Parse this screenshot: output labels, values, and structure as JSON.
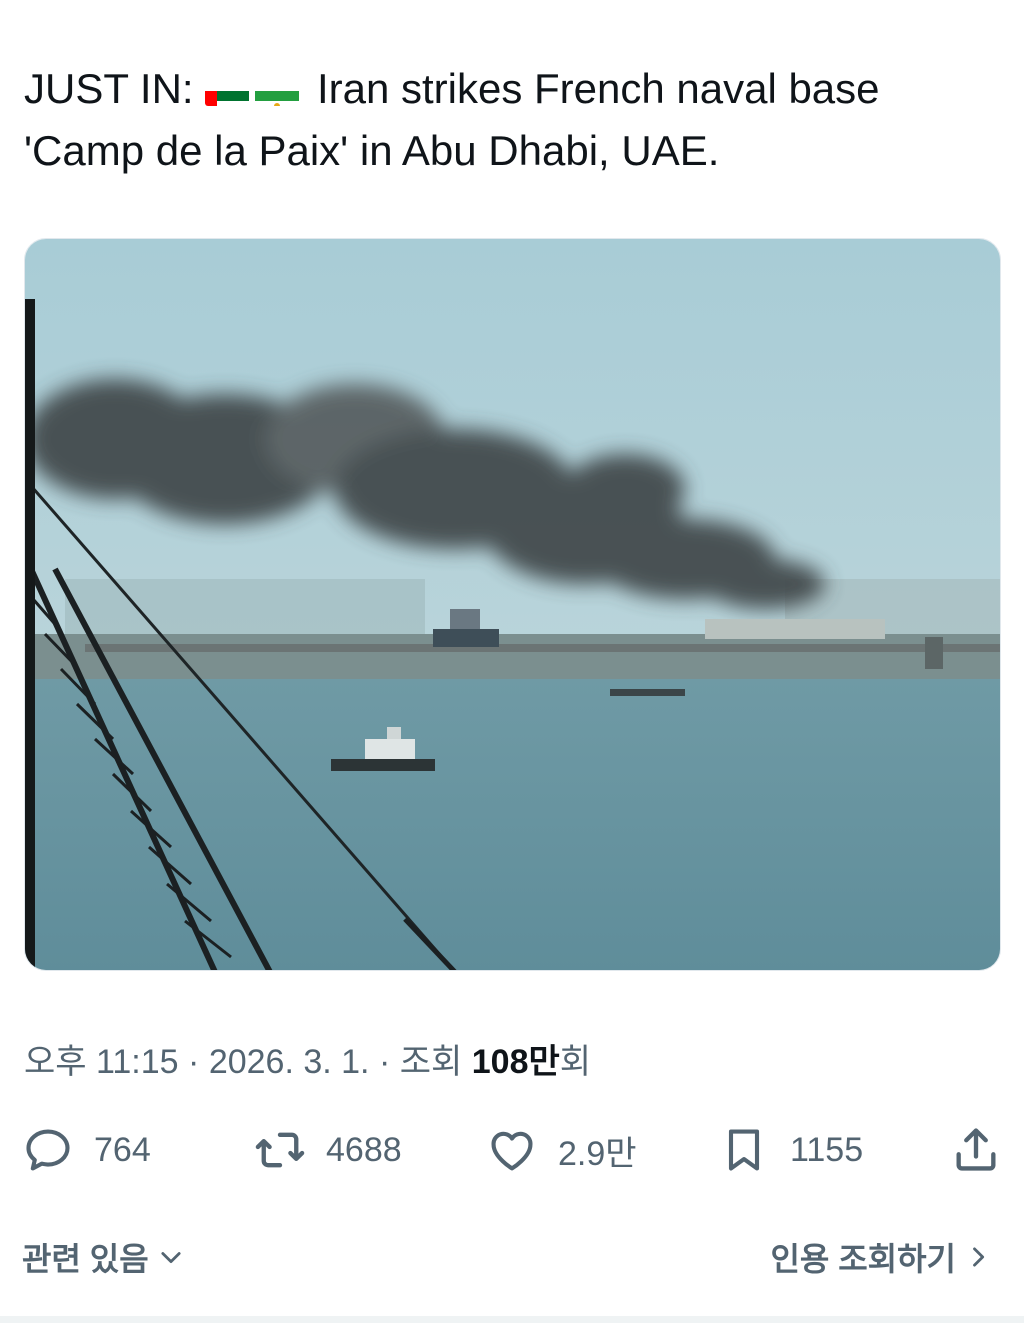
{
  "post": {
    "prefix": "JUST IN:",
    "body_line1": "Iran strikes French naval base",
    "body_line2": "'Camp de la Paix' in Abu Dhabi, UAE."
  },
  "meta": {
    "time": "오후 11:15",
    "sep1": "·",
    "date": "2026. 3. 1.",
    "sep2": "·",
    "views_label": "조회",
    "views_count": "108만",
    "views_suffix": "회"
  },
  "actions": {
    "replies": "764",
    "reposts": "4688",
    "likes": "2.9만",
    "bookmarks": "1155"
  },
  "footer": {
    "related": "관련 있음",
    "quotes": "인용 조회하기"
  },
  "colors": {
    "text": "#0f1419",
    "muted": "#536471"
  }
}
